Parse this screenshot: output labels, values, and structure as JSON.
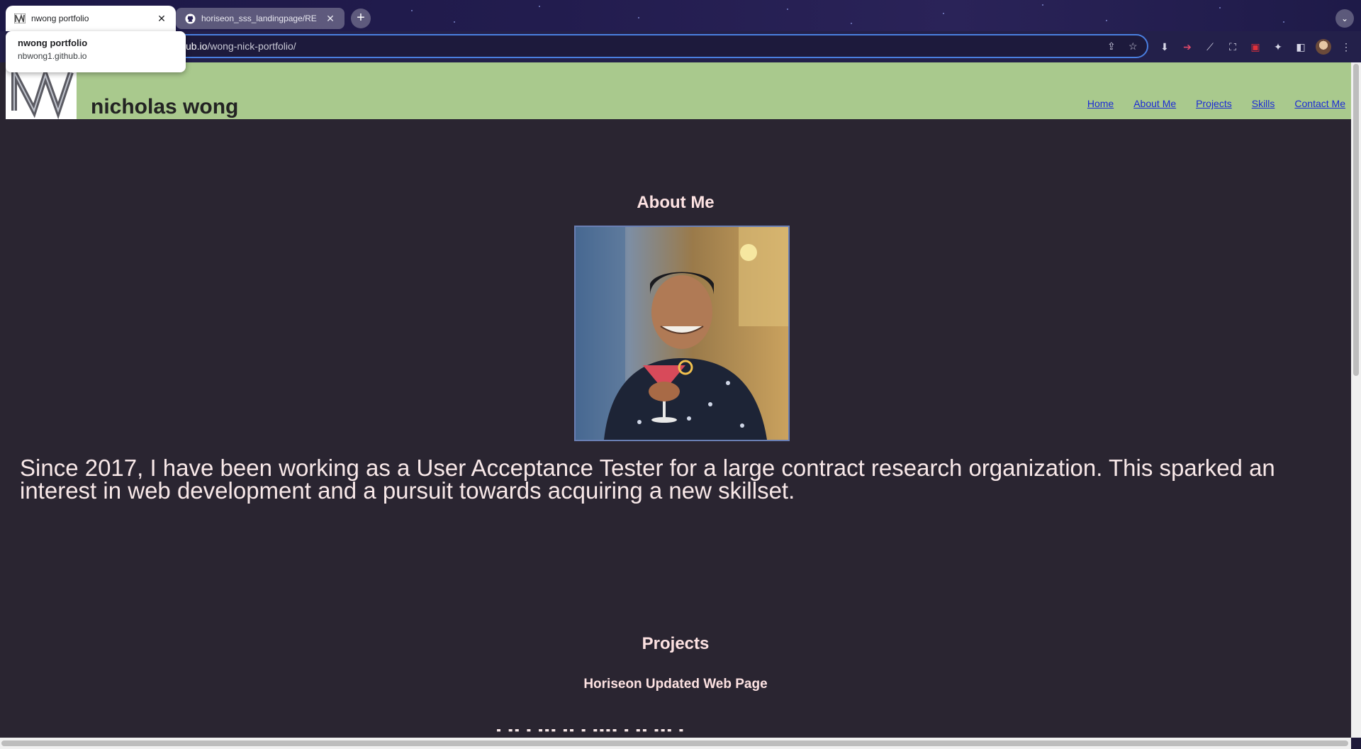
{
  "browser": {
    "tabs": [
      {
        "title": "nwong portfolio",
        "active": true
      },
      {
        "title": "horiseon_sss_landingpage/RE",
        "active": false
      }
    ],
    "hovercard": {
      "title": "nwong portfolio",
      "url": "nbwong1.github.io"
    },
    "address": {
      "host": "ub.io",
      "path": "/wong-nick-portfolio/"
    }
  },
  "site": {
    "name": "nicholas wong",
    "nav": [
      "Home",
      "About Me",
      "Projects",
      "Skills",
      "Contact Me"
    ]
  },
  "about": {
    "title": "About Me",
    "text": "Since 2017, I have been working as a User Acceptance Tester for a large contract research organization. This sparked an interest in web development and a pursuit towards acquiring a new skillset."
  },
  "projects": {
    "title": "Projects",
    "items": [
      {
        "name": "Horiseon Updated Web Page"
      }
    ]
  },
  "colors": {
    "header": "#a9c98d",
    "page_bg": "#2a2531",
    "heading_text": "#fde2e2",
    "nav_link": "#1b2bd6"
  }
}
